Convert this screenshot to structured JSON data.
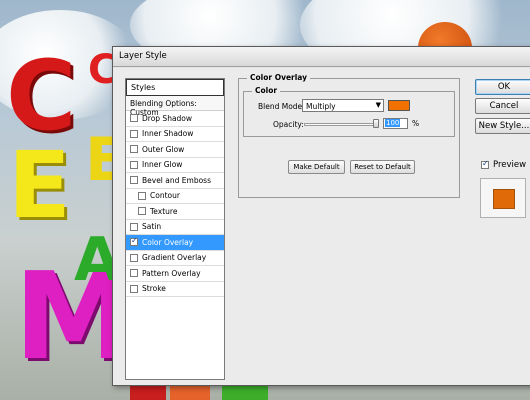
{
  "dialog": {
    "title": "Layer Style"
  },
  "styles_panel": {
    "header": "Styles",
    "blending_options": "Blending Options: Custom",
    "items": [
      {
        "label": "Drop Shadow",
        "checked": false,
        "indent": false,
        "selected": false
      },
      {
        "label": "Inner Shadow",
        "checked": false,
        "indent": false,
        "selected": false
      },
      {
        "label": "Outer Glow",
        "checked": false,
        "indent": false,
        "selected": false
      },
      {
        "label": "Inner Glow",
        "checked": false,
        "indent": false,
        "selected": false
      },
      {
        "label": "Bevel and Emboss",
        "checked": false,
        "indent": false,
        "selected": false
      },
      {
        "label": "Contour",
        "checked": false,
        "indent": true,
        "selected": false
      },
      {
        "label": "Texture",
        "checked": false,
        "indent": true,
        "selected": false
      },
      {
        "label": "Satin",
        "checked": false,
        "indent": false,
        "selected": false
      },
      {
        "label": "Color Overlay",
        "checked": true,
        "indent": false,
        "selected": true
      },
      {
        "label": "Gradient Overlay",
        "checked": false,
        "indent": false,
        "selected": false
      },
      {
        "label": "Pattern Overlay",
        "checked": false,
        "indent": false,
        "selected": false
      },
      {
        "label": "Stroke",
        "checked": false,
        "indent": false,
        "selected": false
      }
    ]
  },
  "color_overlay": {
    "group_title": "Color Overlay",
    "subgroup_title": "Color",
    "blend_mode_label": "Blend Mode:",
    "blend_mode_value": "Multiply",
    "overlay_color": "#f07000",
    "opacity_label": "Opacity:",
    "opacity_value": "100",
    "opacity_unit": "%",
    "opacity_fraction": 1.0,
    "make_default_label": "Make Default",
    "reset_default_label": "Reset to Default"
  },
  "buttons": {
    "ok": "OK",
    "cancel": "Cancel",
    "new_style": "New Style...",
    "preview_label": "Preview",
    "preview_checked": true
  },
  "preview_color": "#e06a08"
}
